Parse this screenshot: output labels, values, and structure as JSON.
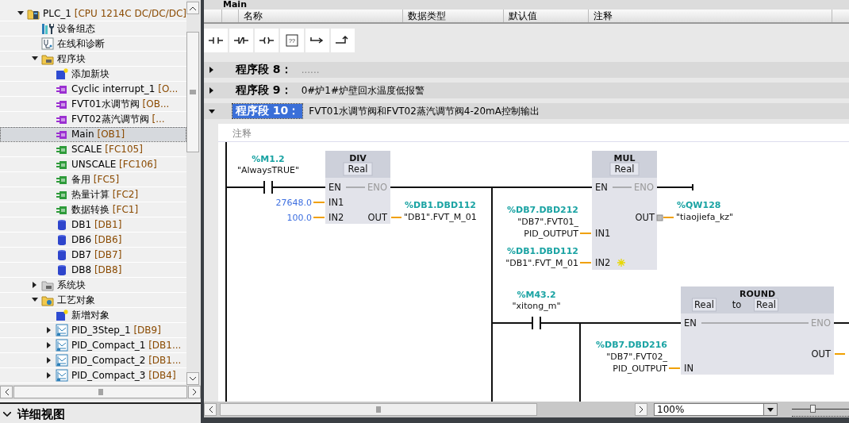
{
  "project_tree": {
    "items": [
      {
        "name": "PLC_1",
        "tag": "[CPU 1214C DC/DC/DC]",
        "kind": "plc",
        "expanded": true,
        "selected": false,
        "children": [
          {
            "name": "设备组态",
            "kind": "device",
            "selected": false
          },
          {
            "name": "在线和诊断",
            "kind": "diagnostics",
            "selected": false
          },
          {
            "name": "程序块",
            "kind": "folder",
            "expanded": true,
            "selected": false,
            "children": [
              {
                "name": "添加新块",
                "kind": "add",
                "selected": false
              },
              {
                "name": "Cyclic interrupt_1",
                "tag": "[O...",
                "kind": "ob",
                "selected": false
              },
              {
                "name": "FVT01水调节阀",
                "tag": "[OB...",
                "kind": "ob",
                "selected": false
              },
              {
                "name": "FVT02蒸汽调节阀",
                "tag": "[...",
                "kind": "ob",
                "selected": false
              },
              {
                "name": "Main",
                "tag": "[OB1]",
                "kind": "ob",
                "selected": true
              },
              {
                "name": "SCALE",
                "tag": "[FC105]",
                "kind": "fc",
                "selected": false
              },
              {
                "name": "UNSCALE",
                "tag": "[FC106]",
                "kind": "fc",
                "selected": false
              },
              {
                "name": "备用",
                "tag": "[FC5]",
                "kind": "fc",
                "selected": false
              },
              {
                "name": "热量计算",
                "tag": "[FC2]",
                "kind": "fc",
                "selected": false
              },
              {
                "name": "数据转换",
                "tag": "[FC1]",
                "kind": "fc",
                "selected": false
              },
              {
                "name": "DB1",
                "tag": "[DB1]",
                "kind": "db",
                "selected": false
              },
              {
                "name": "DB6",
                "tag": "[DB6]",
                "kind": "db",
                "selected": false
              },
              {
                "name": "DB7",
                "tag": "[DB7]",
                "kind": "db",
                "selected": false
              },
              {
                "name": "DB8",
                "tag": "[DB8]",
                "kind": "db",
                "selected": false
              }
            ]
          },
          {
            "name": "系统块",
            "kind": "folder-gray",
            "expanded": false,
            "selected": false
          },
          {
            "name": "工艺对象",
            "kind": "folder-tech",
            "expanded": true,
            "selected": false,
            "children": [
              {
                "name": "新增对象",
                "kind": "add",
                "selected": false
              },
              {
                "name": "PID_3Step_1",
                "tag": "[DB9]",
                "kind": "pid",
                "expanded": false,
                "selected": false
              },
              {
                "name": "PID_Compact_1",
                "tag": "[DB1...",
                "kind": "pid",
                "expanded": false,
                "selected": false
              },
              {
                "name": "PID_Compact_2",
                "tag": "[DB1...",
                "kind": "pid",
                "expanded": false,
                "selected": false
              },
              {
                "name": "PID_Compact_3",
                "tag": "[DB4]",
                "kind": "pid",
                "expanded": false,
                "selected": false
              }
            ]
          }
        ]
      }
    ]
  },
  "detail_view": {
    "title": "详细视图"
  },
  "editor": {
    "title": "Main",
    "interface_columns": [
      "名称",
      "数据类型",
      "默认值",
      "注释"
    ],
    "toolbar": [
      {
        "kind": "no-contact"
      },
      {
        "kind": "nc-contact"
      },
      {
        "kind": "coil"
      },
      {
        "kind": "empty-box",
        "glyph": "??"
      },
      {
        "kind": "open-branch"
      },
      {
        "kind": "close-branch"
      }
    ],
    "networks": [
      {
        "label": "程序段 8：",
        "comment": "......",
        "expanded": false,
        "selected": false
      },
      {
        "label": "程序段 9：",
        "comment": "0#炉1#炉壁回水温度低报警",
        "expanded": false,
        "selected": false
      },
      {
        "label": "程序段 10：",
        "comment": "FVT01水调节阀和FVT02蒸汽调节阀4-20mA控制输出",
        "expanded": true,
        "selected": true
      }
    ],
    "comment_placeholder": "注释",
    "ladder": {
      "contacts": [
        {
          "address": "%M1.2",
          "symbol": "\"AlwaysTRUE\""
        },
        {
          "address": "%M43.2",
          "symbol": "\"xitong_m\""
        }
      ],
      "blocks": [
        {
          "kind": "DIV",
          "title": "DIV",
          "types": [
            "Real"
          ],
          "en": "EN",
          "eno": "ENO",
          "inputs": [
            {
              "pin": "IN1",
              "value": "27648.0"
            },
            {
              "pin": "IN2",
              "value": "100.0"
            }
          ],
          "outputs": [
            {
              "pin": "OUT",
              "address": "%DB1.DBD112",
              "symbol_lines": [
                "\"DB1\".FVT_M_01"
              ]
            }
          ]
        },
        {
          "kind": "MUL",
          "title": "MUL",
          "types": [
            "Real"
          ],
          "en": "EN",
          "eno": "ENO",
          "inputs": [
            {
              "pin": "IN1",
              "address": "%DB7.DBD212",
              "symbol_lines": [
                "\"DB7\".FVT01_",
                "PID_OUTPUT"
              ]
            },
            {
              "pin": "IN2",
              "address": "%DB1.DBD112",
              "symbol_lines": [
                "\"DB1\".FVT_M_01"
              ],
              "add_input": true
            }
          ],
          "outputs": [
            {
              "pin": "OUT",
              "address": "%QW128",
              "symbol_lines": [
                "\"tiaojiefa_kz\""
              ],
              "edge_marker": true
            }
          ]
        },
        {
          "kind": "ROUND",
          "title": "ROUND",
          "types": [
            "Real",
            "Real"
          ],
          "type_joiner": "to",
          "en": "EN",
          "eno": "ENO",
          "inputs": [
            {
              "pin": "IN",
              "address": "%DB7.DBD216",
              "symbol_lines": [
                "\"DB7\".FVT02_",
                "PID_OUTPUT"
              ]
            }
          ],
          "outputs": [
            {
              "pin": "OUT"
            }
          ]
        }
      ]
    },
    "zoom": {
      "value": "100%",
      "level": 0.35
    }
  }
}
